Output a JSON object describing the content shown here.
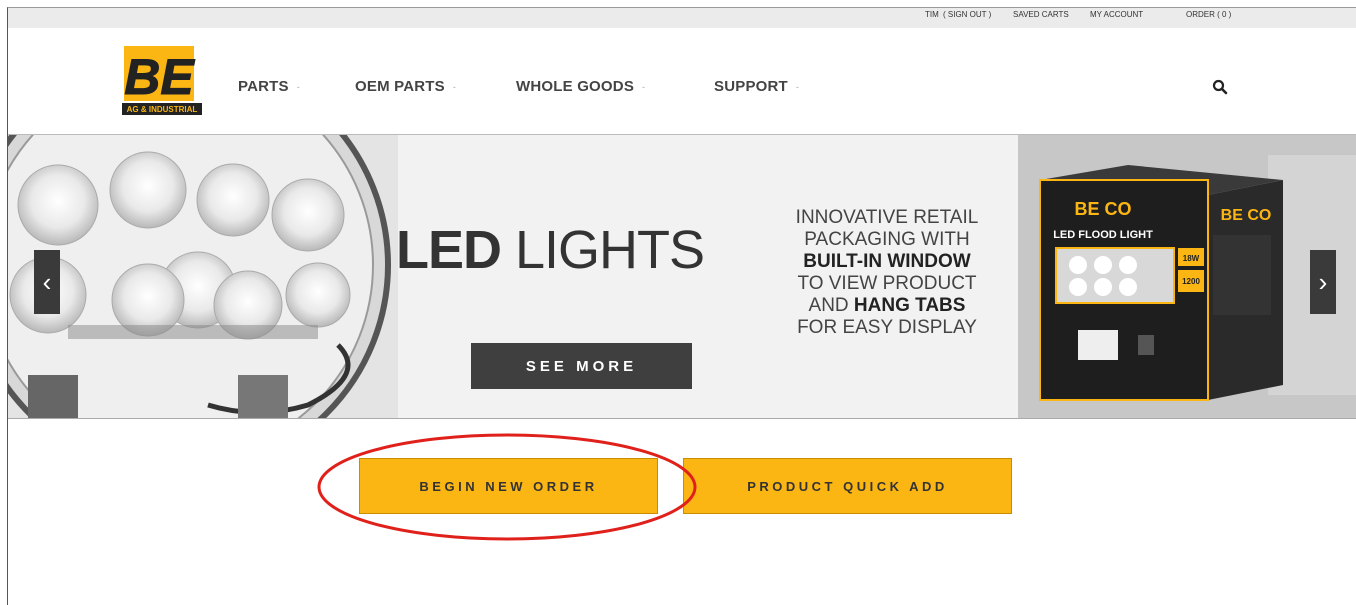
{
  "utility_bar": {
    "user": "TIM",
    "sign_out": "( SIGN OUT )",
    "saved_carts": "SAVED CARTS",
    "my_account": "MY ACCOUNT",
    "order": "ORDER ( 0 )"
  },
  "logo": {
    "letters": "BE",
    "subtitle": "AG & INDUSTRIAL"
  },
  "nav": {
    "items": [
      {
        "label": "PARTS"
      },
      {
        "label": "OEM PARTS"
      },
      {
        "label": "WHOLE GOODS"
      },
      {
        "label": "SUPPORT"
      }
    ],
    "caret": "-"
  },
  "banner": {
    "headline_bold": "LED",
    "headline_light": "LIGHTS",
    "tagline": {
      "line1": "INNOVATIVE RETAIL",
      "line2": "PACKAGING WITH",
      "line3": "BUILT-IN WINDOW",
      "line4": "TO VIEW PRODUCT",
      "line5_pre": "AND ",
      "line5_bold": "HANG TABS",
      "line6": "FOR EASY DISPLAY"
    },
    "cta": "SEE MORE",
    "product_box": {
      "brand": "BE CO",
      "label": "LED FLOOD LIGHT",
      "watts": "18W",
      "lumens": "1200"
    },
    "prev_icon": "‹",
    "next_icon": "›"
  },
  "actions": {
    "begin_new_order": "BEGIN NEW ORDER",
    "product_quick_add": "PRODUCT QUICK ADD"
  },
  "colors": {
    "accent": "#fbb614",
    "dark": "#3f3f3f",
    "highlight": "#e0201a"
  }
}
